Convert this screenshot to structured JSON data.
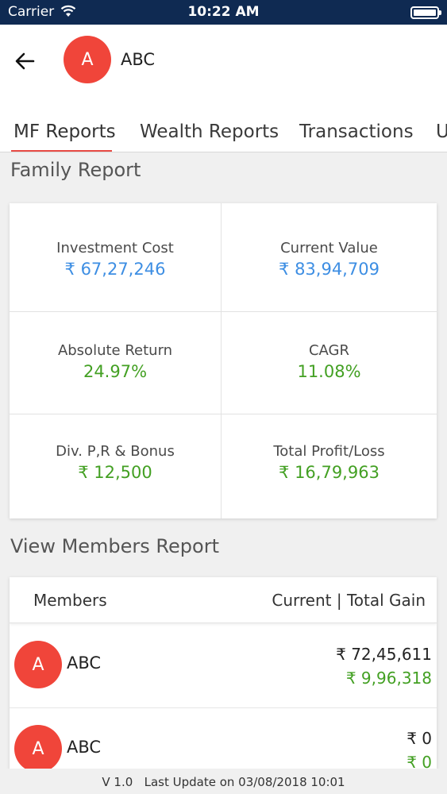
{
  "status_bar": {
    "carrier": "Carrier",
    "time": "10:22 AM"
  },
  "header": {
    "avatar_initial": "A",
    "user_name": "ABC",
    "tabs": [
      {
        "label": "MF Reports",
        "active": true
      },
      {
        "label": "Wealth Reports",
        "active": false
      },
      {
        "label": "Transactions",
        "active": false
      },
      {
        "label": "U",
        "active": false
      }
    ]
  },
  "family_report": {
    "title": "Family Report",
    "metrics": [
      {
        "label": "Investment Cost",
        "value": "₹ 67,27,246",
        "color": "#3d8ee3"
      },
      {
        "label": "Current Value",
        "value": "₹ 83,94,709",
        "color": "#3d8ee3"
      },
      {
        "label": "Absolute Return",
        "value": "24.97%",
        "color": "#43a023"
      },
      {
        "label": "CAGR",
        "value": "11.08%",
        "color": "#43a023"
      },
      {
        "label": "Div. P,R & Bonus",
        "value": "₹ 12,500",
        "color": "#43a023"
      },
      {
        "label": "Total Profit/Loss",
        "value": "₹ 16,79,963",
        "color": "#43a023"
      }
    ]
  },
  "members_report": {
    "title": "View Members Report",
    "col_members": "Members",
    "col_values": "Current | Total Gain",
    "rows": [
      {
        "initial": "A",
        "name": "ABC",
        "current": "₹ 72,45,611",
        "gain": "₹ 9,96,318"
      },
      {
        "initial": "A",
        "name": "ABC",
        "current": "₹ 0",
        "gain": "₹ 0"
      }
    ]
  },
  "footer": {
    "version": "V  1.0",
    "last_update": "Last Update on 03/08/2018 10:01"
  },
  "colors": {
    "status_bar": "#0f2a52",
    "accent_red": "#f0453a",
    "tab_underline": "#e84b45",
    "value_blue": "#3d8ee3",
    "value_green": "#43a023"
  }
}
